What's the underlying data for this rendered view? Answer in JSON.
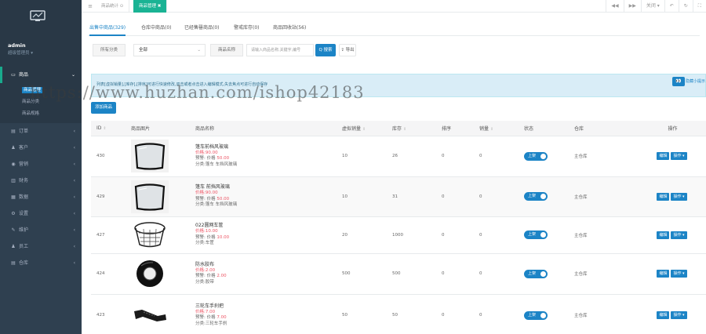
{
  "sidebar": {
    "user": "admin",
    "role": "超级管理员",
    "menu": [
      {
        "icon": "▭",
        "label": "商品",
        "active": true
      },
      {
        "icon": "▤",
        "label": "订单"
      },
      {
        "icon": "♟",
        "label": "客户"
      },
      {
        "icon": "◉",
        "label": "营销"
      },
      {
        "icon": "▥",
        "label": "财务"
      },
      {
        "icon": "▦",
        "label": "数据"
      },
      {
        "icon": "⚙",
        "label": "设置"
      },
      {
        "icon": "✎",
        "label": "维护"
      },
      {
        "icon": "♟",
        "label": "员工"
      },
      {
        "icon": "▤",
        "label": "仓库"
      }
    ],
    "submenu": [
      "商品管理",
      "商品分类",
      "商品规格"
    ]
  },
  "topbar": {
    "toggle": "≡",
    "tabs": [
      "商品统计 ⊙",
      "商品管理 ✖"
    ],
    "right": [
      "◀◀",
      "▶▶",
      "关闭 ▾",
      "↶",
      "↻",
      "⛶"
    ]
  },
  "tabs": [
    "出售中商品(329)",
    "仓库中商品(0)",
    "已经售罄商品(0)",
    "警戒库存(0)",
    "商品回收站(56)"
  ],
  "filters": {
    "category_label": "所有分类",
    "category_value": "全部",
    "name_label": "商品名称",
    "search_placeholder": "请输入商品名称,关键字,编号",
    "search_btn": "Q 搜索",
    "export_btn": "⇪ 导出"
  },
  "tip": {
    "text": "列表[虚拟销量],[库存],[排序]可进行快速修改,双击或者点击进入编辑模式,失去焦点可进行自动保存",
    "link": "隐藏小提示"
  },
  "add_button": "添加商品",
  "watermark": "https://www.huzhan.com/ishop42183",
  "table": {
    "headers": [
      "ID",
      "商品图片",
      "商品名称",
      "虚拟销量",
      "库存",
      "排序",
      "销量",
      "状态",
      "仓库",
      "操作"
    ],
    "rows": [
      {
        "id": "430",
        "img": "windshield",
        "name": "篷车前档风玻璃",
        "price": "价格:90.00",
        "warn": "预警: 价格",
        "warn_val": "50.00",
        "cat": "分类:篷车 车挡风玻璃",
        "virtual": "10",
        "stock": "26",
        "sort": "0",
        "sales": "0",
        "status": "上架",
        "warehouse": "主仓库"
      },
      {
        "id": "429",
        "img": "windshield",
        "name": "篷车 前挡风玻璃",
        "price": "价格:90.00",
        "warn": "预警: 价格",
        "warn_val": "50.00",
        "cat": "分类:篷车 车挡风玻璃",
        "virtual": "10",
        "stock": "31",
        "sort": "0",
        "sales": "0",
        "status": "上架",
        "warehouse": "主仓库"
      },
      {
        "id": "427",
        "img": "basket",
        "name": "022圆网车筐",
        "price": "价格:10.00",
        "warn": "预警: 价格",
        "warn_val": "10.00",
        "cat": "分类:车筐",
        "virtual": "20",
        "stock": "1000",
        "sort": "0",
        "sales": "0",
        "status": "上架",
        "warehouse": "主仓库"
      },
      {
        "id": "424",
        "img": "tape",
        "name": "防水胶布",
        "price": "价格:2.00",
        "warn": "预警: 价格",
        "warn_val": "2.00",
        "cat": "分类:胶带",
        "virtual": "500",
        "stock": "500",
        "sort": "0",
        "sales": "0",
        "status": "上架",
        "warehouse": "主仓库"
      },
      {
        "id": "423",
        "img": "grip",
        "name": "三轮车手刹把",
        "price": "价格:7.00",
        "warn": "预警: 价格",
        "warn_val": "7.00",
        "cat": "分类:三轮车手刹",
        "virtual": "50",
        "stock": "50",
        "sort": "0",
        "sales": "0",
        "status": "上架",
        "warehouse": "主仓库"
      }
    ],
    "op_edit": "编辑",
    "op_more": "操作 ▾"
  },
  "colors": {
    "sidebar": "#2f4050",
    "accent": "#1c84c6",
    "green": "#1ab394",
    "price_red": "#ed5565"
  }
}
